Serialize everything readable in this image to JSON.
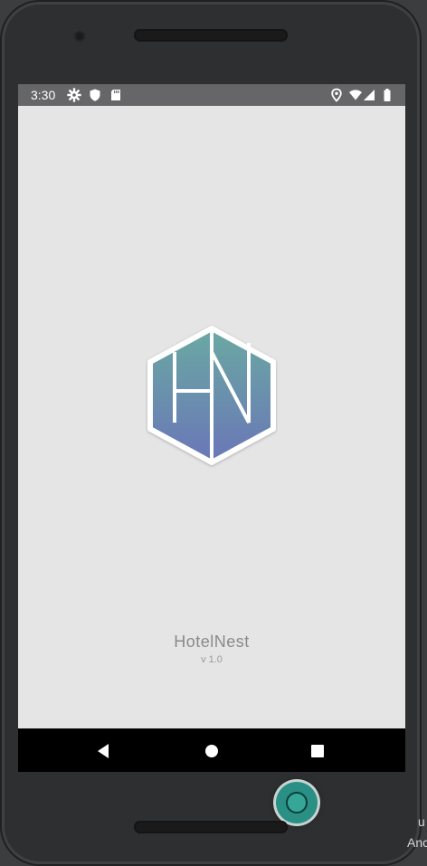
{
  "status_bar": {
    "time": "3:30",
    "left_icons": [
      "gear-icon",
      "shield-icon",
      "sd-card-icon"
    ],
    "right_icons": [
      "location-icon",
      "wifi-icon",
      "signal-icon",
      "battery-icon"
    ]
  },
  "app": {
    "logo_letters": "HN",
    "name": "HotelNest",
    "version": "v 1.0",
    "logo_colors": {
      "top": "#6aa9a2",
      "bottom": "#6b76b8",
      "border": "#ffffff"
    }
  },
  "nav_bar": {
    "buttons": [
      "back-icon",
      "home-circle-icon",
      "recents-square-icon"
    ]
  },
  "side_text": {
    "line1": "u",
    "line2": "Anc"
  }
}
